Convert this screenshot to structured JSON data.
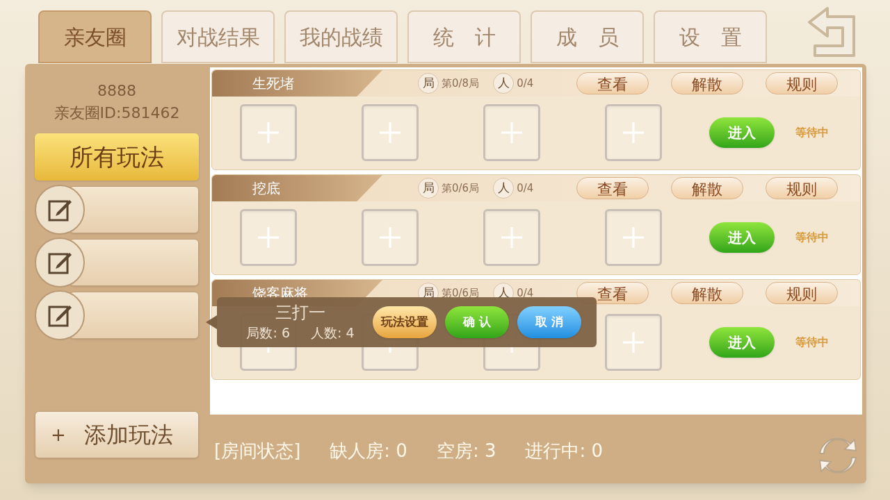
{
  "tabs": [
    {
      "label": "亲友圈",
      "selected": true
    },
    {
      "label": "对战结果",
      "selected": false
    },
    {
      "label": "我的战绩",
      "selected": false
    },
    {
      "label": "统　计",
      "selected": false
    },
    {
      "label": "成　员",
      "selected": false
    },
    {
      "label": "设　置",
      "selected": false
    }
  ],
  "sidebar": {
    "name": "8888",
    "club_id": "亲友圈ID:581462",
    "all_modes": {
      "label": "所有玩法",
      "selected": true
    },
    "mode_slots": [
      {
        "kind": "empty"
      },
      {
        "kind": "empty"
      },
      {
        "kind": "empty"
      }
    ],
    "add_button": {
      "icon": "+",
      "label": "添加玩法"
    }
  },
  "rooms": [
    {
      "title": "生死堵",
      "rounds_icon": "局",
      "rounds": "第0/8局",
      "players_icon": "人",
      "players": "0/4",
      "buttons": [
        "查看",
        "解散",
        "规则"
      ],
      "seats": [
        {
          "occupied": false
        },
        {
          "occupied": false
        },
        {
          "occupied": false
        },
        {
          "occupied": false
        }
      ],
      "enter": "进入",
      "status": "等待中"
    },
    {
      "title": "挖底",
      "rounds_icon": "局",
      "rounds": "第0/6局",
      "players_icon": "人",
      "players": "0/4",
      "buttons": [
        "查看",
        "解散",
        "规则"
      ],
      "seats": [
        {
          "occupied": false
        },
        {
          "occupied": false
        },
        {
          "occupied": false
        },
        {
          "occupied": false
        }
      ],
      "enter": "进入",
      "status": "等待中"
    },
    {
      "title": "饶客麻将",
      "rounds_icon": "局",
      "rounds": "第0/6局",
      "players_icon": "人",
      "players": "0/4",
      "buttons": [
        "查看",
        "解散",
        "规则"
      ],
      "seats": [
        {
          "occupied": false
        },
        {
          "occupied": false
        },
        {
          "occupied": false
        },
        {
          "occupied": false
        }
      ],
      "enter": "进入",
      "status": "等待中"
    }
  ],
  "popup": {
    "title": "三打一",
    "rounds": "局数: 6",
    "players": "人数: 4",
    "buttons": [
      {
        "kind": "settings",
        "label": "玩法设置"
      },
      {
        "kind": "confirm",
        "label": "确 认"
      },
      {
        "kind": "cancel",
        "label": "取 消"
      }
    ]
  },
  "footer": [
    "[房间状态]",
    "缺人房: 0",
    "空房: 3",
    "进行中: 0"
  ]
}
